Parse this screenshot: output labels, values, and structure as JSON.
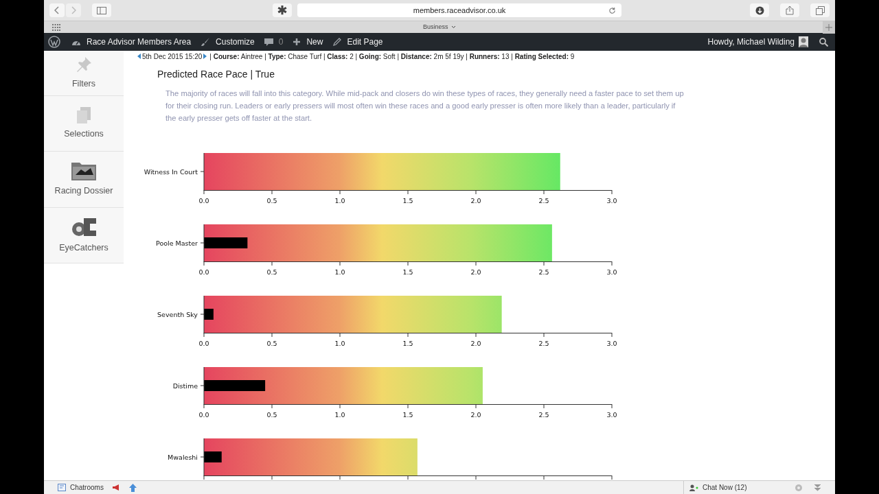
{
  "browser": {
    "url": "members.raceadvisor.co.uk",
    "tab_group": "Business"
  },
  "admin_bar": {
    "site": "Race Advisor Members Area",
    "customize": "Customize",
    "comments": "0",
    "new": "New",
    "edit": "Edit Page",
    "greeting": "Howdy, Michael Wilding"
  },
  "sidebar": {
    "items": [
      {
        "label": "Filters"
      },
      {
        "label": "Selections"
      },
      {
        "label": "Racing Dossier"
      },
      {
        "label": "EyeCatchers"
      }
    ]
  },
  "race_info": {
    "date": "5th Dec 2015 15:20",
    "details": "| **Course:** Aintree | **Type:** Chase Turf | **Class:** 2 | **Going:** Soft | **Distance:** 2m 5f 19y | **Runners:** 13 | **Rating Selected:** 9"
  },
  "title": "Predicted Race Pace | True",
  "description": "The majority of races will fall into this category. While mid-pack and closers do win these types of races, they generally need a faster pace to set them up for their closing run. Leaders or early pressers will most often win these races and a good early presser is often more likely than a leader, particularly if the early presser gets off faster at the start.",
  "charts": [
    {
      "chart_data": {
        "type": "bar",
        "orientation": "horizontal",
        "categories": [
          "Witness In Court"
        ],
        "series": [
          {
            "values": [
              2.62
            ]
          }
        ],
        "xlim": [
          0,
          3
        ],
        "xticks": [
          {
            "value": 0,
            "label": "0.0"
          },
          {
            "value": 0.5,
            "label": "0.5"
          },
          {
            "value": 1,
            "label": "1.0"
          },
          {
            "value": 1.5,
            "label": "1.5"
          },
          {
            "value": 2,
            "label": "2.0"
          },
          {
            "value": 2.5,
            "label": "2.5"
          },
          {
            "value": 3,
            "label": "3.0"
          }
        ]
      }
    },
    {
      "chart_data": {
        "type": "bar",
        "orientation": "horizontal",
        "categories": [
          "Poole Master"
        ],
        "series": [
          {
            "values": [
              2.56
            ]
          },
          {
            "color": "#000000",
            "values": [
              0.32
            ]
          }
        ],
        "xlim": [
          0,
          3
        ],
        "xticks": [
          {
            "value": 0,
            "label": "0.0"
          },
          {
            "value": 0.5,
            "label": "0.5"
          },
          {
            "value": 1,
            "label": "1.0"
          },
          {
            "value": 1.5,
            "label": "1.5"
          },
          {
            "value": 2,
            "label": "2.0"
          },
          {
            "value": 2.5,
            "label": "2.5"
          },
          {
            "value": 3,
            "label": "3.0"
          }
        ]
      }
    },
    {
      "chart_data": {
        "type": "bar",
        "orientation": "horizontal",
        "categories": [
          "Seventh Sky"
        ],
        "series": [
          {
            "values": [
              2.19
            ]
          },
          {
            "color": "#000000",
            "values": [
              0.07
            ]
          }
        ],
        "xlim": [
          0,
          3
        ],
        "xticks": [
          {
            "value": 0,
            "label": "0.0"
          },
          {
            "value": 0.5,
            "label": "0.5"
          },
          {
            "value": 1,
            "label": "1.0"
          },
          {
            "value": 1.5,
            "label": "1.5"
          },
          {
            "value": 2,
            "label": "2.0"
          },
          {
            "value": 2.5,
            "label": "2.5"
          },
          {
            "value": 3,
            "label": "3.0"
          }
        ]
      }
    },
    {
      "chart_data": {
        "type": "bar",
        "orientation": "horizontal",
        "categories": [
          "Distime"
        ],
        "series": [
          {
            "values": [
              2.05
            ]
          },
          {
            "color": "#000000",
            "values": [
              0.45
            ]
          }
        ],
        "xlim": [
          0,
          3
        ],
        "xticks": [
          {
            "value": 0,
            "label": "0.0"
          },
          {
            "value": 0.5,
            "label": "0.5"
          },
          {
            "value": 1,
            "label": "1.0"
          },
          {
            "value": 1.5,
            "label": "1.5"
          },
          {
            "value": 2,
            "label": "2.0"
          },
          {
            "value": 2.5,
            "label": "2.5"
          },
          {
            "value": 3,
            "label": "3.0"
          }
        ]
      }
    },
    {
      "chart_data": {
        "type": "bar",
        "orientation": "horizontal",
        "categories": [
          "Mwaleshi"
        ],
        "series": [
          {
            "values": [
              1.57
            ]
          },
          {
            "color": "#000000",
            "values": [
              0.13
            ]
          }
        ],
        "xlim": [
          0,
          3
        ]
      }
    }
  ],
  "footer": {
    "chatrooms": "Chatrooms",
    "chat": "Chat Now (12)"
  }
}
